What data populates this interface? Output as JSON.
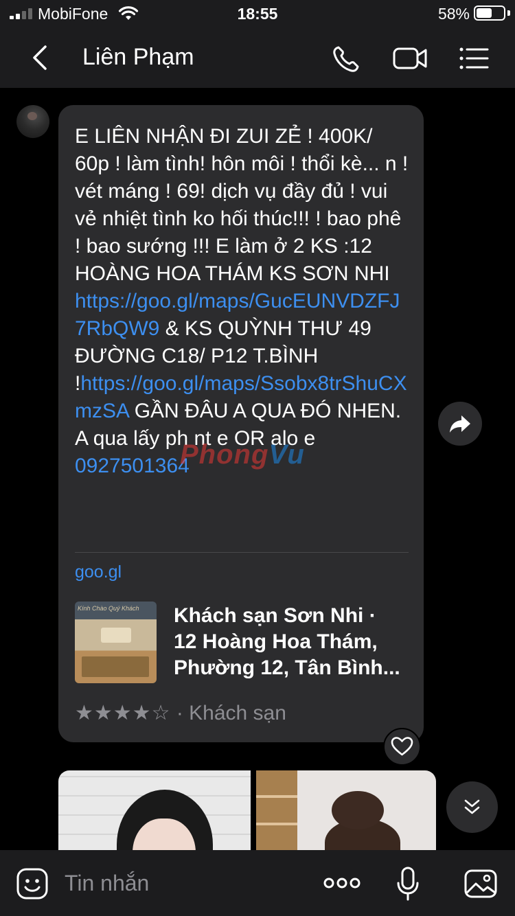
{
  "status_bar": {
    "carrier": "MobiFone",
    "time": "18:55",
    "battery_percent": "58%",
    "battery_level": 0.58
  },
  "header": {
    "contact_name": "Liên Phạm"
  },
  "message": {
    "segments": [
      {
        "text": "E LIÊN NHẬN ĐI ZUI ZẺ ! 400K/ 60p ! làm tình! hôn môi ! thổi kè... n ! vét máng ! 69!  dịch vụ đầy đủ ! vui vẻ nhiệt tình ko hối thúc!!! ! bao phê ! bao sướng !!! E làm ở 2 KS :12 HOÀNG HOA THÁM KS SƠN NHI ",
        "link": false
      },
      {
        "text": "https://goo.gl/maps/GucEUNVDZFJ7RbQW9",
        "link": true
      },
      {
        "text": " &  KS QUỲNH THƯ 49 ĐƯỜNG C18/ P12 T.BÌNH !",
        "link": false
      },
      {
        "text": "https://goo.gl/maps/Ssobx8trShuCXmzSA",
        "link": true
      },
      {
        "text": " GẦN ĐÂU A QUA ĐÓ NHEN. A qua lấy ph nt e OR alo e ",
        "link": false
      },
      {
        "text": "0927501364",
        "link": true
      }
    ],
    "link_preview": {
      "domain": "goo.gl",
      "thumbnail_sign": "Kính Chào Quý Khách",
      "title": "Khách sạn Sơn Nhi ·\n12 Hoàng Hoa Thám,\nPhường 12, Tân Bình...",
      "stars": "★★★★☆",
      "rating_value": 4,
      "category": " · Khách sạn"
    }
  },
  "watermark": {
    "part1": "Phong",
    "part2": "Vu"
  },
  "composer": {
    "placeholder": "Tin nhắn"
  },
  "colors": {
    "background": "#000000",
    "bar": "#1c1c1e",
    "bubble": "#2c2c2e",
    "link": "#3d8ff0",
    "muted": "#8e8e93"
  }
}
